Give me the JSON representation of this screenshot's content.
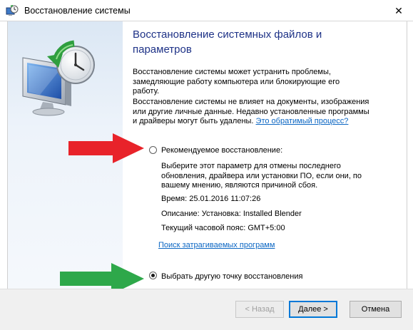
{
  "window": {
    "title": "Восстановление системы",
    "close_glyph": "✕"
  },
  "content": {
    "heading": "Восстановление системных файлов и параметров",
    "paragraph1": "Восстановление системы может устранить проблемы, замедляющие работу компьютера или блокирующие его работу.",
    "paragraph2": "Восстановление системы не влияет на документы, изображения или другие личные данные. Недавно установленные программы и драйверы могут быть удалены.",
    "reversible_link": "Это обратимый процесс?"
  },
  "recommended": {
    "label": "Рекомендуемое восстановление:",
    "selected": false,
    "description": "Выберите этот параметр для отмены последнего обновления, драйвера или установки ПО, если они, по вашему мнению, являются причиной сбоя.",
    "time": "Время: 25.01.2016 11:07:26",
    "description_line": "Описание: Установка: Installed Blender",
    "timezone": "Текущий часовой пояс: GMT+5:00",
    "affected_link": "Поиск затрагиваемых программ"
  },
  "other": {
    "label": "Выбрать другую точку восстановления",
    "selected": true
  },
  "buttons": {
    "back": "< Назад",
    "next": "Далее >",
    "cancel": "Отмена"
  },
  "annotations": {
    "arrow1_color": "#e8232a",
    "arrow2_color": "#2ea84a"
  }
}
